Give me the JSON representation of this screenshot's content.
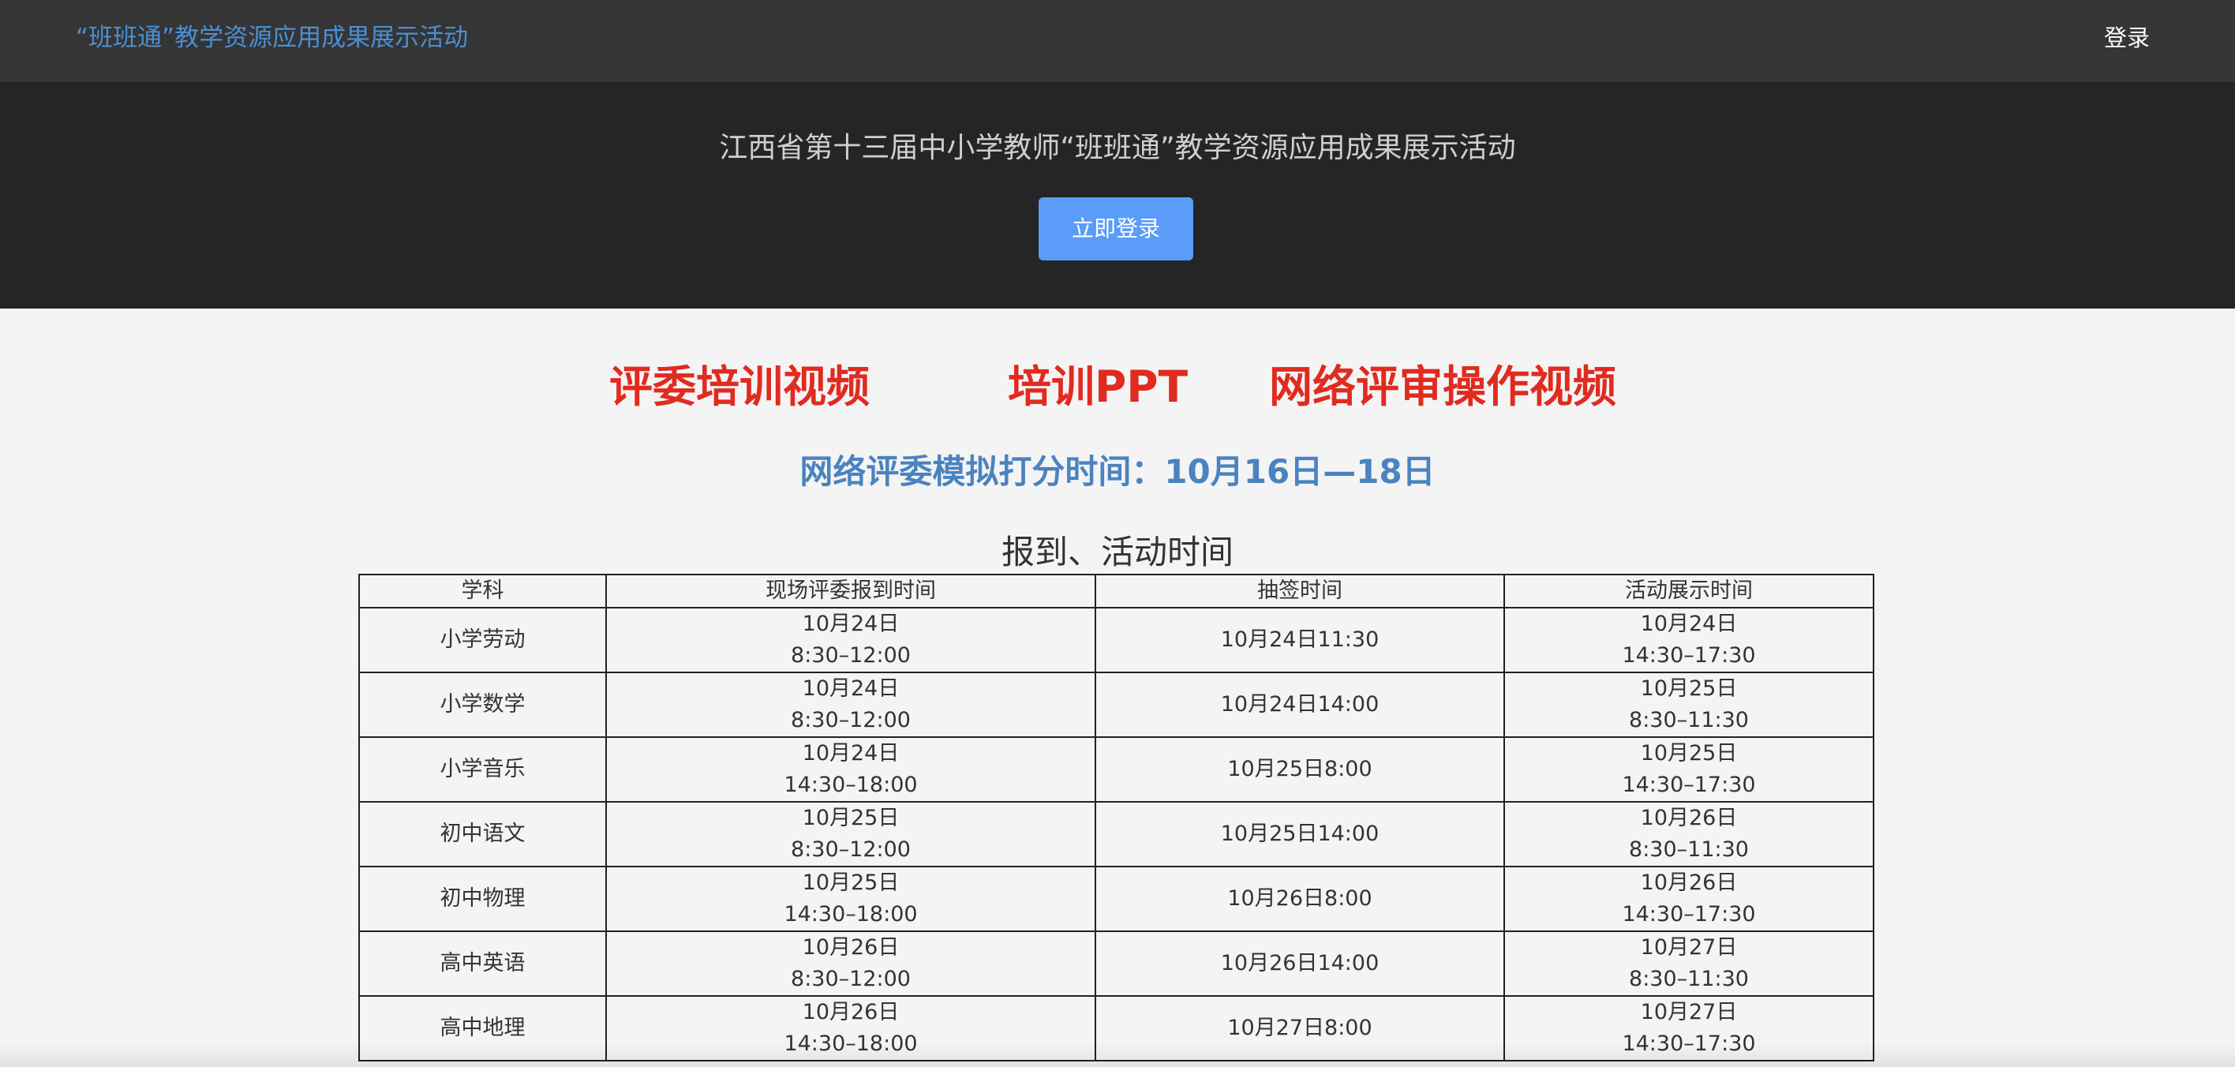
{
  "navbar": {
    "brand": "“班班通”教学资源应用成果展示活动",
    "login_label": "登录"
  },
  "hero": {
    "title": "江西省第十三届中小学教师“班班通”教学资源应用成果展示活动",
    "button_label": "立即登录"
  },
  "links": [
    {
      "label": "评委培训视频"
    },
    {
      "label": "培训PPT"
    },
    {
      "label": "网络评审操作视频"
    }
  ],
  "notice": "网络评委模拟打分时间：10月16日—18日",
  "schedule": {
    "title": "报到、活动时间",
    "headers": [
      "学科",
      "现场评委报到时间",
      "抽签时间",
      "活动展示时间"
    ],
    "rows": [
      {
        "subject": "小学劳动",
        "report_date": "10月24日",
        "report_time": "8:30–12:00",
        "draw": "10月24日11:30",
        "show_date": "10月24日",
        "show_time": "14:30–17:30"
      },
      {
        "subject": "小学数学",
        "report_date": "10月24日",
        "report_time": "8:30–12:00",
        "draw": "10月24日14:00",
        "show_date": "10月25日",
        "show_time": "8:30–11:30"
      },
      {
        "subject": "小学音乐",
        "report_date": "10月24日",
        "report_time": "14:30–18:00",
        "draw": "10月25日8:00",
        "show_date": "10月25日",
        "show_time": "14:30–17:30"
      },
      {
        "subject": "初中语文",
        "report_date": "10月25日",
        "report_time": "8:30–12:00",
        "draw": "10月25日14:00",
        "show_date": "10月26日",
        "show_time": "8:30–11:30"
      },
      {
        "subject": "初中物理",
        "report_date": "10月25日",
        "report_time": "14:30–18:00",
        "draw": "10月26日8:00",
        "show_date": "10月26日",
        "show_time": "14:30–17:30"
      },
      {
        "subject": "高中英语",
        "report_date": "10月26日",
        "report_time": "8:30–12:00",
        "draw": "10月26日14:00",
        "show_date": "10月27日",
        "show_time": "8:30–11:30"
      },
      {
        "subject": "高中地理",
        "report_date": "10月26日",
        "report_time": "14:30–18:00",
        "draw": "10月27日8:00",
        "show_date": "10月27日",
        "show_time": "14:30–17:30"
      }
    ]
  },
  "colors": {
    "navbar_bg": "#353535",
    "hero_bg": "#252525",
    "brand": "#4a8fd4",
    "button": "#5a9cf8",
    "link_red": "#e02b20",
    "notice_blue": "#4a83c0"
  }
}
